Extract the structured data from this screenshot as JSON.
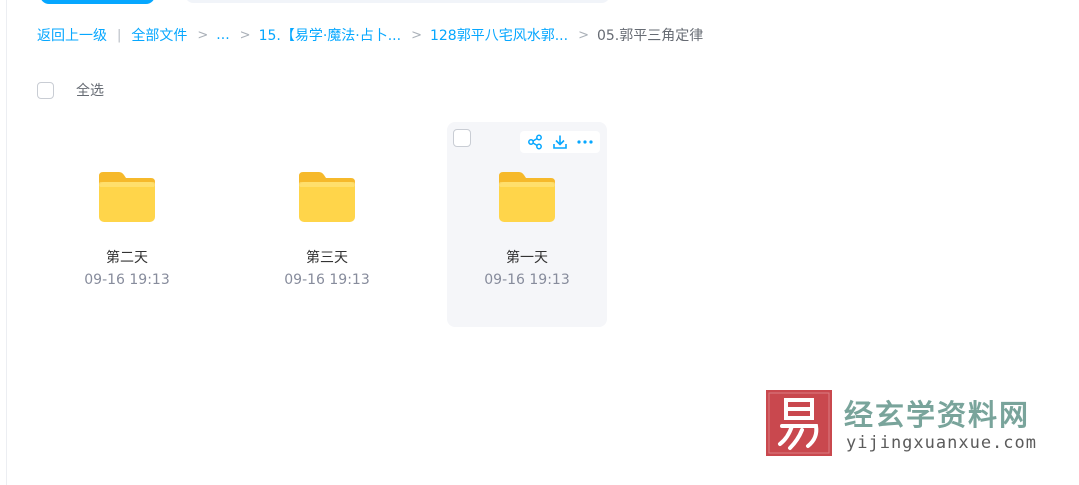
{
  "breadcrumb": {
    "back": "返回上一级",
    "all_files": "全部文件",
    "ellipsis": "...",
    "level1": "15.【易学·魔法·占卜...",
    "level2": "128郭平八宅风水郭...",
    "current": "05.郭平三角定律",
    "separator": ">",
    "divider": "|"
  },
  "toolbar": {
    "select_all_label": "全选"
  },
  "folders": [
    {
      "name": "第二天",
      "time": "09-16 19:13"
    },
    {
      "name": "第三天",
      "time": "09-16 19:13"
    },
    {
      "name": "第一天",
      "time": "09-16 19:13"
    }
  ],
  "hover_actions": {
    "share_icon": "share-icon",
    "download_icon": "download-icon",
    "more_icon": "more-icon"
  },
  "watermark": {
    "title": "经玄学资料网",
    "url": "yijingxuanxue.com",
    "seal_glyph": "易"
  },
  "colors": {
    "accent": "#06a7ff",
    "folder": "#ffd54a",
    "watermark_seal": "#c9484e",
    "watermark_text": "#6e9d93"
  }
}
